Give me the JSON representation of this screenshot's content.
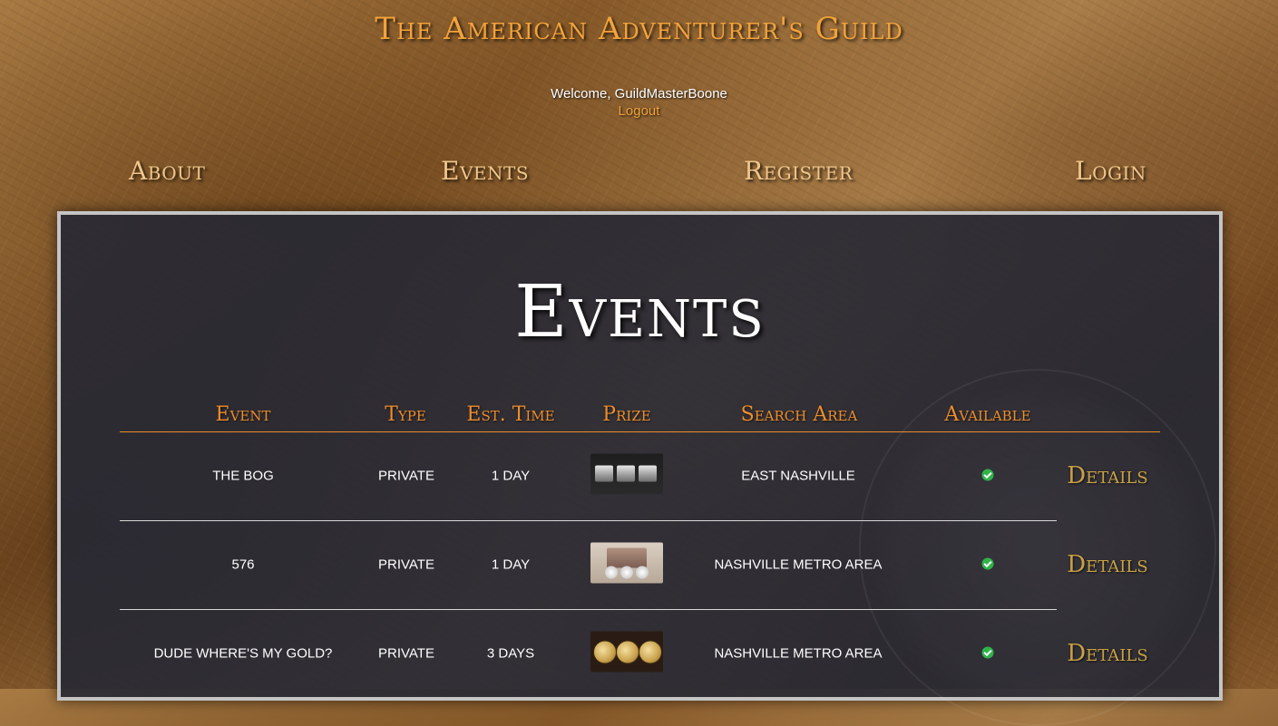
{
  "site": {
    "title": "The American Adventurer's Guild",
    "welcome": "Welcome, GuildMasterBoone",
    "logout": "Logout"
  },
  "nav": {
    "about": "About",
    "events": "Events",
    "register": "Register",
    "login": "Login"
  },
  "page": {
    "heading": "Events"
  },
  "table": {
    "headers": {
      "event": "Event",
      "type": "Type",
      "est_time": "Est. Time",
      "prize": "Prize",
      "search_area": "Search Area",
      "available": "Available"
    },
    "rows": [
      {
        "event": "The Bog",
        "type": "Private",
        "est_time": "1 day",
        "prize_image": "silver-bars",
        "search_area": "East Nashville",
        "available": true,
        "available_icon": "check-circle-icon",
        "details": "Details"
      },
      {
        "event": "576",
        "type": "Private",
        "est_time": "1 day",
        "prize_image": "silver-coins-box",
        "search_area": "Nashville Metro Area",
        "available": true,
        "available_icon": "check-circle-icon",
        "details": "Details"
      },
      {
        "event": "Dude where's my gold?",
        "type": "Private",
        "est_time": "3 days",
        "prize_image": "gold-coins",
        "search_area": "Nashville Metro Area",
        "available": true,
        "available_icon": "check-circle-icon",
        "details": "Details"
      }
    ]
  },
  "colors": {
    "accent_orange": "#ee8d2a",
    "title_orange": "#f2a33a",
    "nav_gold": "#f0c68a",
    "details_gold": "#c8a144",
    "panel_bg": "#262834",
    "available_green": "#2fb34a"
  }
}
